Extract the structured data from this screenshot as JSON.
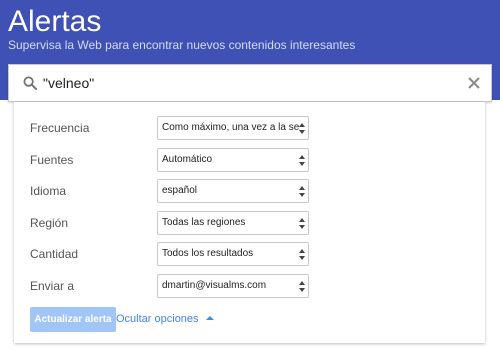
{
  "header": {
    "title": "Alertas",
    "subtitle": "Supervisa la Web para encontrar nuevos contenidos interesantes"
  },
  "search": {
    "value": "\"velneo\"",
    "icon": "search-icon",
    "clear_icon": "close-icon"
  },
  "options": [
    {
      "label": "Frecuencia",
      "value": "Como máximo, una vez a la semana"
    },
    {
      "label": "Fuentes",
      "value": "Automático"
    },
    {
      "label": "Idioma",
      "value": "español"
    },
    {
      "label": "Región",
      "value": "Todas las regiones"
    },
    {
      "label": "Cantidad",
      "value": "Todos los resultados"
    },
    {
      "label": "Enviar a",
      "value": "dmartin@visualms.com"
    }
  ],
  "actions": {
    "update_label": "Actualizar alerta",
    "hide_options_label": "Ocultar opciones"
  },
  "colors": {
    "header_bg": "#3f51b5",
    "link": "#4285f4",
    "button_disabled": "#a1c5f7"
  }
}
